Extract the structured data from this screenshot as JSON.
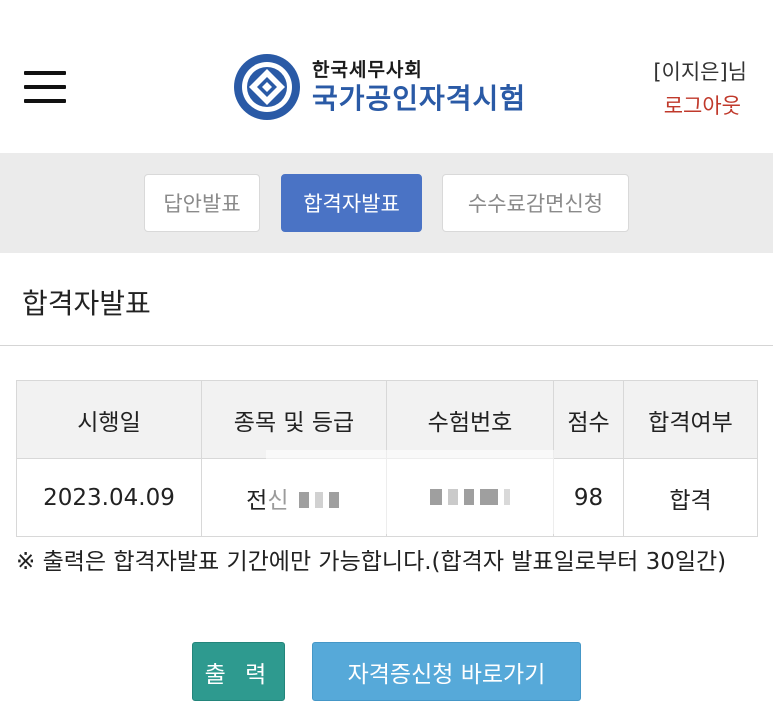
{
  "header": {
    "logo_small": "한국세무사회",
    "logo_big": "국가공인자격시험",
    "user_name": "[이지은]님",
    "logout_label": "로그아웃"
  },
  "tabs": [
    {
      "label": "답안발표",
      "active": false
    },
    {
      "label": "합격자발표",
      "active": true
    },
    {
      "label": "수수료감면신청",
      "active": false
    }
  ],
  "section_title": "합격자발표",
  "table": {
    "headers": [
      "시행일",
      "종목 및 등급",
      "수험번호",
      "점수",
      "합격여부"
    ],
    "rows": [
      {
        "date": "2023.04.09",
        "subject_visible": "전신",
        "score": "98",
        "result": "합격"
      }
    ]
  },
  "note": "※ 출력은 합격자발표 기간에만 가능합니다.(합격자 발표일로부터 30일간)",
  "buttons": {
    "print_label": "출 력",
    "certificate_label": "자격증신청 바로가기"
  },
  "colors": {
    "active_tab": "#4a73c5",
    "logout": "#c0392b",
    "print_button": "#2e9a8f",
    "certificate_button": "#56a9d9",
    "brand_blue": "#2a5aa6"
  }
}
